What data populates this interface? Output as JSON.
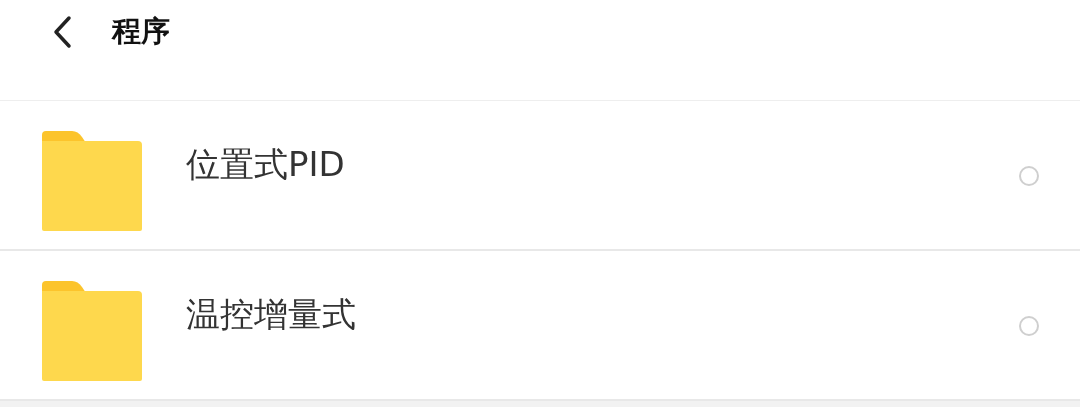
{
  "header": {
    "title": "程序"
  },
  "items": [
    {
      "name": "位置式PID",
      "selected": false
    },
    {
      "name": "温控增量式",
      "selected": false
    }
  ]
}
